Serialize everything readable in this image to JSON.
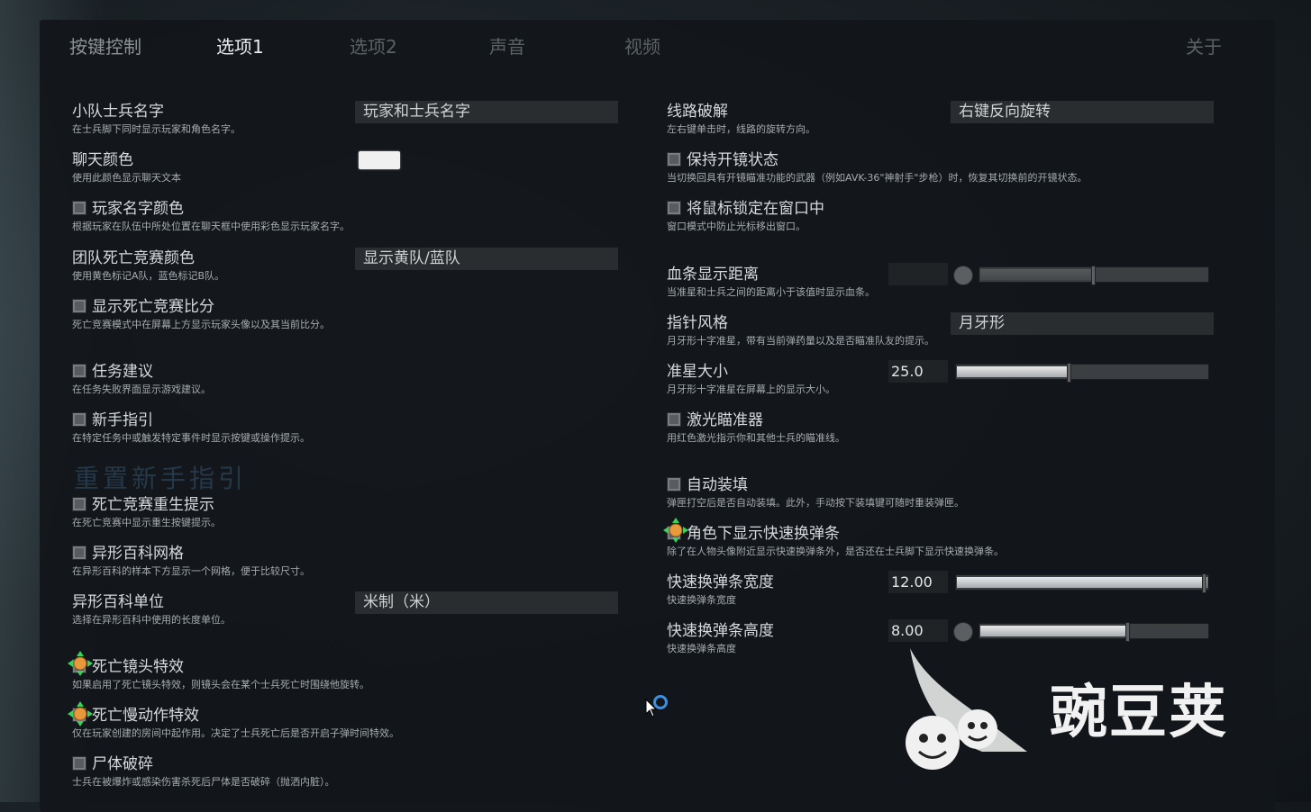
{
  "tabs": [
    {
      "label": "按键控制"
    },
    {
      "label": "选项1"
    },
    {
      "label": "选项2"
    },
    {
      "label": "声音"
    },
    {
      "label": "视频"
    },
    {
      "label": "关于"
    }
  ],
  "left": {
    "squad_name": {
      "label": "小队士兵名字",
      "desc": "在士兵脚下同时显示玩家和角色名字。",
      "value": "玩家和士兵名字"
    },
    "chat_color": {
      "label": "聊天颜色",
      "desc": "使用此颜色显示聊天文本",
      "color": "#f0f0f0"
    },
    "player_name_color": {
      "label": "玩家名字颜色",
      "desc": "根据玩家在队伍中所处位置在聊天框中使用彩色显示玩家名字。"
    },
    "tdm_color": {
      "label": "团队死亡竞赛颜色",
      "desc": "使用黄色标记A队，蓝色标记B队。",
      "value": "显示黄队/蓝队"
    },
    "show_dm_score": {
      "label": "显示死亡竞赛比分",
      "desc": "死亡竞赛模式中在屏幕上方显示玩家头像以及其当前比分。"
    },
    "mission_advice": {
      "label": "任务建议",
      "desc": "在任务失败界面显示游戏建议。"
    },
    "tutorial": {
      "label": "新手指引",
      "desc": "在特定任务中或触发特定事件时显示按键或操作提示。"
    },
    "reset_tutorial": {
      "label": "重置新手指引"
    },
    "dm_respawn": {
      "label": "死亡竞赛重生提示",
      "desc": "在死亡竞赛中显示重生按键提示。"
    },
    "xeno_grid": {
      "label": "异形百科网格",
      "desc": "在异形百科的样本下方显示一个网格，便于比较尺寸。"
    },
    "xeno_unit": {
      "label": "异形百科单位",
      "desc": "选择在异形百科中使用的长度单位。",
      "value": "米制（米）"
    },
    "death_cam": {
      "label": "死亡镜头特效",
      "desc": "如果启用了死亡镜头特效，则镜头会在某个士兵死亡时围绕他旋转。"
    },
    "death_slowmo": {
      "label": "死亡慢动作特效",
      "desc": "仅在玩家创建的房间中起作用。决定了士兵死亡后是否开启子弹时间特效。"
    },
    "gibs": {
      "label": "尸体破碎",
      "desc": "士兵在被爆炸或感染伤害杀死后尸体是否破碎（抛洒内脏）。"
    }
  },
  "right": {
    "hack": {
      "label": "线路破解",
      "desc": "左右键单击时，线路的旋转方向。",
      "value": "右键反向旋转"
    },
    "keep_scope": {
      "label": "保持开镜状态",
      "desc": "当切换回具有开镜瞄准功能的武器（例如AVK-36\"神射手\"步枪）时，恢复其切换前的开镜状态。"
    },
    "lock_mouse": {
      "label": "将鼠标锁定在窗口中",
      "desc": "窗口模式中防止光标移出窗口。"
    },
    "hp_distance": {
      "label": "血条显示距离",
      "desc": "当准星和士兵之间的距离小于该值时显示血条。",
      "value": "",
      "level": 0.5
    },
    "cursor_style": {
      "label": "指针风格",
      "desc": "月牙形十字准星，带有当前弹药量以及是否瞄准队友的提示。",
      "value": "月牙形"
    },
    "crosshair_size": {
      "label": "准星大小",
      "desc": "月牙形十字准星在屏幕上的显示大小。",
      "value": "25.0",
      "level": 0.45
    },
    "laser": {
      "label": "激光瞄准器",
      "desc": "用红色激光指示你和其他士兵的瞄准线。"
    },
    "auto_reload": {
      "label": "自动装填",
      "desc": "弹匣打空后是否自动装填。此外，手动按下装填键可随时重装弹匣。"
    },
    "quick_mag_bar": {
      "label": "角色下显示快速换弹条",
      "desc": "除了在人物头像附近显示快速换弹条外，是否还在士兵脚下显示快速换弹条。"
    },
    "quick_mag_width": {
      "label": "快速换弹条宽度",
      "desc": "快速换弹条宽度",
      "value": "12.00",
      "level": 1.0
    },
    "quick_mag_height": {
      "label": "快速换弹条高度",
      "desc": "快速换弹条高度",
      "value": "8.00",
      "level": 0.65
    }
  },
  "watermark": {
    "text": "豌豆荚"
  }
}
